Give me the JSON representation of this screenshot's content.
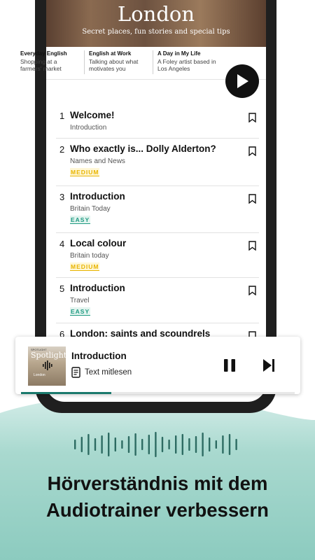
{
  "hero": {
    "title": "London",
    "subtitle": "Secret places, fun stories and special tips"
  },
  "categories": [
    {
      "heading": "Everyday English",
      "text": "Shopping at a farmers' market"
    },
    {
      "heading": "English at Work",
      "text": "Talking about what motivates you"
    },
    {
      "heading": "A Day in My Life",
      "text": "A Foley artist based in Los Angeles"
    }
  ],
  "episodes": [
    {
      "number": "1",
      "title": "Welcome!",
      "subtitle": "Introduction",
      "level": ""
    },
    {
      "number": "2",
      "title": "Who exactly is... Dolly Alderton?",
      "subtitle": "Names and News",
      "level": "MEDIUM"
    },
    {
      "number": "3",
      "title": "Introduction",
      "subtitle": "Britain Today",
      "level": "EASY"
    },
    {
      "number": "4",
      "title": "Local colour",
      "subtitle": "Britain today",
      "level": "MEDIUM"
    },
    {
      "number": "5",
      "title": "Introduction",
      "subtitle": "Travel",
      "level": "EASY"
    },
    {
      "number": "6",
      "title": "London: saints and scoundrels",
      "subtitle": "",
      "level": ""
    }
  ],
  "player": {
    "title": "Introduction",
    "read_along": "Text mitlesen",
    "cover_brand": "SPOTLIGHT",
    "cover_title": "Spotlight",
    "cover_sub": "London",
    "progress": 0.33
  },
  "headline": {
    "line1": "Hörverständnis mit dem",
    "line2": "Audiotrainer verbessern"
  },
  "colors": {
    "teal": "#a9d9cf",
    "accent_teal": "#1b7a6d",
    "medium": "#e8b400",
    "easy": "#1f9a82"
  }
}
